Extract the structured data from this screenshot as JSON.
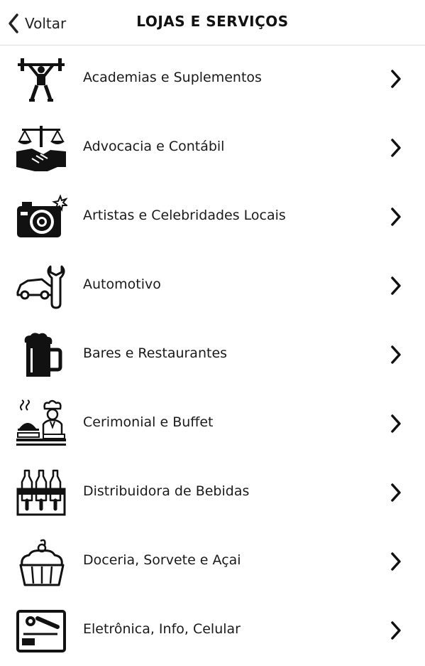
{
  "header": {
    "back_label": "Voltar",
    "title": "LOJAS E SERVIÇOS"
  },
  "categories": [
    {
      "label": "Academias e Suplementos",
      "icon": "weightlifter-icon"
    },
    {
      "label": "Advocacia e Contábil",
      "icon": "scales-handshake-icon"
    },
    {
      "label": "Artistas e Celebridades Locais",
      "icon": "camera-icon"
    },
    {
      "label": "Automotivo",
      "icon": "car-wrench-icon"
    },
    {
      "label": "Bares e Restaurantes",
      "icon": "beer-mug-icon"
    },
    {
      "label": "Cerimonial e Buffet",
      "icon": "chef-icon"
    },
    {
      "label": "Distribuidora de Bebidas",
      "icon": "bottles-crate-icon"
    },
    {
      "label": "Doceria, Sorvete e Açai",
      "icon": "cupcake-icon"
    },
    {
      "label": "Eletrônica, Info, Celular",
      "icon": "electronics-icon"
    }
  ],
  "colors": {
    "text": "#111111",
    "divider": "#dcdcdc",
    "background": "#ffffff"
  }
}
